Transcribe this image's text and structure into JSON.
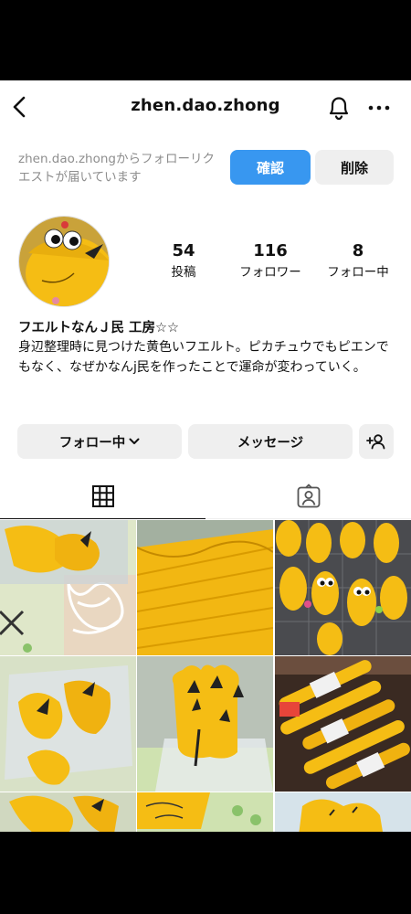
{
  "header": {
    "username": "zhen.dao.zhong",
    "back_icon": "chevron-left-icon",
    "notification_icon": "bell-icon",
    "more_icon": "more-horizontal-icon"
  },
  "follow_request": {
    "text": "zhen.dao.zhongからフォローリクエストが届いています",
    "confirm_label": "確認",
    "delete_label": "削除"
  },
  "profile": {
    "stats": [
      {
        "value": "54",
        "label": "投稿"
      },
      {
        "value": "116",
        "label": "フォロワー"
      },
      {
        "value": "8",
        "label": "フォロー中"
      }
    ],
    "display_name": "フエルトなんＪ民 工房☆☆",
    "bio": "身辺整理時に見つけた黄色いフエルト。ピカチュウでもピエンでもなく、なぜかなんj民を作ったことで運命が変わっていく。"
  },
  "actions": {
    "following_label": "フォロー中",
    "message_label": "メッセージ"
  },
  "tabs": {
    "grid_icon": "grid-icon",
    "tagged_icon": "tagged-person-icon"
  },
  "colors": {
    "accent": "#3897f0",
    "button_bg": "#efefef",
    "felt_yellow": "#f5bd14"
  }
}
